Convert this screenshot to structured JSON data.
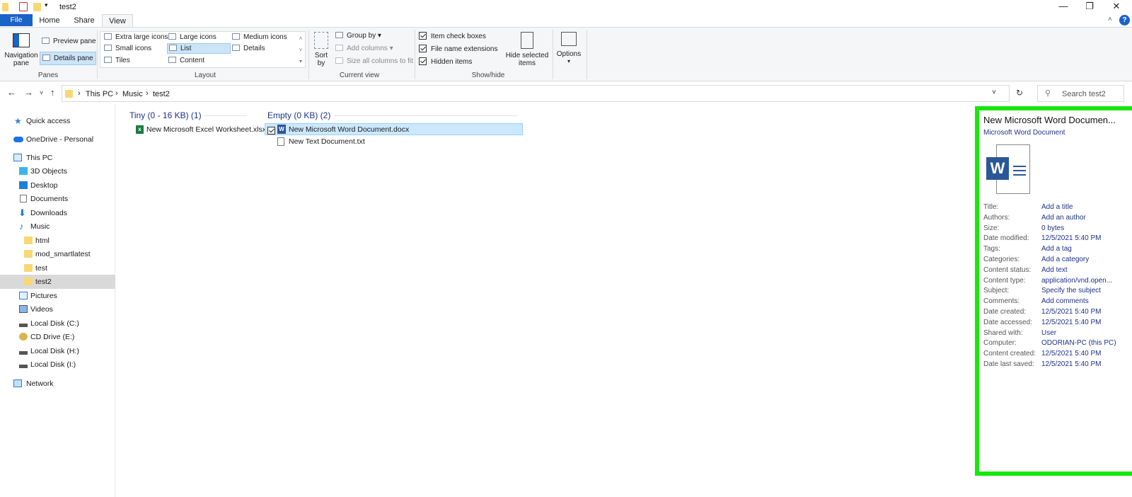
{
  "window": {
    "title": "test2",
    "controls": [
      "—",
      "❐",
      "✕"
    ]
  },
  "tabs": {
    "file": "File",
    "home": "Home",
    "share": "Share",
    "view": "View"
  },
  "ribbon": {
    "panes": {
      "navigation_pane": "Navigation pane",
      "preview_pane": "Preview pane",
      "details_pane": "Details pane",
      "label": "Panes"
    },
    "layout": {
      "items": [
        "Extra large icons",
        "Large icons",
        "Medium icons",
        "Small icons",
        "List",
        "Details",
        "Tiles",
        "Content"
      ],
      "selected": "List",
      "label": "Layout"
    },
    "current_view": {
      "sort_by": "Sort by",
      "group_by": "Group by",
      "add_columns": "Add columns",
      "size_all_columns": "Size all columns to fit",
      "label": "Current view"
    },
    "show_hide": {
      "item_check_boxes": "Item check boxes",
      "file_name_extensions": "File name extensions",
      "hidden_items": "Hidden items",
      "hide_selected_items": "Hide selected items",
      "label": "Show/hide"
    },
    "options": "Options"
  },
  "address": {
    "path": [
      "This PC",
      "Music",
      "test2"
    ],
    "search_placeholder": "Search test2"
  },
  "nav_pane": {
    "items": [
      {
        "label": "Quick access",
        "icon": "star-icon"
      },
      {
        "label": "OneDrive - Personal",
        "icon": "cloud-icon"
      },
      {
        "label": "This PC",
        "icon": "computer-icon"
      },
      {
        "label": "3D Objects",
        "icon": "cube-icon"
      },
      {
        "label": "Desktop",
        "icon": "desktop-icon"
      },
      {
        "label": "Documents",
        "icon": "document-icon"
      },
      {
        "label": "Downloads",
        "icon": "download-icon"
      },
      {
        "label": "Music",
        "icon": "music-icon"
      },
      {
        "label": "html",
        "icon": "folder-icon"
      },
      {
        "label": "mod_smartlatest",
        "icon": "folder-icon"
      },
      {
        "label": "test",
        "icon": "folder-icon"
      },
      {
        "label": "test2",
        "icon": "folder-icon"
      },
      {
        "label": "Pictures",
        "icon": "pictures-icon"
      },
      {
        "label": "Videos",
        "icon": "videos-icon"
      },
      {
        "label": "Local Disk (C:)",
        "icon": "drive-icon"
      },
      {
        "label": "CD Drive (E:)",
        "icon": "cd-icon"
      },
      {
        "label": "Local Disk (H:)",
        "icon": "drive-icon"
      },
      {
        "label": "Local Disk (I:)",
        "icon": "drive-icon"
      },
      {
        "label": "Network",
        "icon": "network-icon"
      }
    ],
    "selected": "test2"
  },
  "groups": [
    {
      "heading": "Tiny (0 - 16 KB) (1)",
      "files": [
        "New Microsoft Excel Worksheet.xlsx"
      ]
    },
    {
      "heading": "Empty (0 KB) (2)",
      "files": [
        "New Microsoft Word Document.docx",
        "New Text Document.txt"
      ]
    }
  ],
  "details": {
    "title": "New Microsoft Word Documen...",
    "subtitle": "Microsoft Word Document",
    "properties": [
      {
        "key": "Title:",
        "value": "Add a title"
      },
      {
        "key": "Authors:",
        "value": "Add an author"
      },
      {
        "key": "Size:",
        "value": "0 bytes"
      },
      {
        "key": "Date modified:",
        "value": "12/5/2021 5:40 PM"
      },
      {
        "key": "Tags:",
        "value": "Add a tag"
      },
      {
        "key": "Categories:",
        "value": "Add a category"
      },
      {
        "key": "Content status:",
        "value": "Add text"
      },
      {
        "key": "Content type:",
        "value": "application/vnd.open..."
      },
      {
        "key": "Subject:",
        "value": "Specify the subject"
      },
      {
        "key": "Comments:",
        "value": "Add comments"
      },
      {
        "key": "Date created:",
        "value": "12/5/2021 5:40 PM"
      },
      {
        "key": "Date accessed:",
        "value": "12/5/2021 5:40 PM"
      },
      {
        "key": "Shared with:",
        "value": "User"
      },
      {
        "key": "Computer:",
        "value": "ODORIAN-PC (this PC)"
      },
      {
        "key": "Content created:",
        "value": "12/5/2021 5:40 PM"
      },
      {
        "key": "Date last saved:",
        "value": "12/5/2021 5:40 PM"
      }
    ]
  },
  "colors": {
    "accent": "#1a63c8",
    "highlight": "#17e80a",
    "folder": "#f8d775"
  }
}
